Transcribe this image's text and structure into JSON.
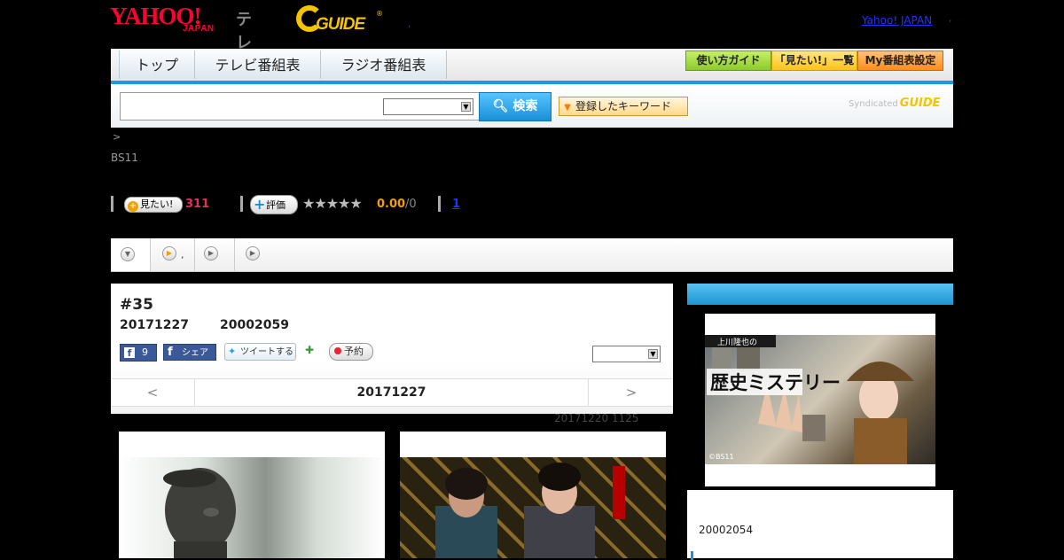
{
  "header": {
    "yahoo_logo": "YAHOO!",
    "yahoo_logo_sub": "JAPAN",
    "tv_label": "テレビ",
    "gguide_logo": "GUIDE",
    "gguide_reg": "®",
    "yahoo_japan_link": "Yahoo! JAPAN",
    "dot_left": ",",
    "dot_right": ","
  },
  "nav": {
    "tabs": [
      {
        "label": "トップ"
      },
      {
        "label": "テレビ番組表"
      },
      {
        "label": "ラジオ番組表"
      }
    ],
    "buttons": [
      {
        "label": "使い方ガイド",
        "color": "#9bd43a"
      },
      {
        "label": "「見たい!」一覧",
        "color": "#ffcc33"
      },
      {
        "label": "My番組表設定",
        "color": "#ff9a33"
      }
    ]
  },
  "search": {
    "input_value": "",
    "select_value": "",
    "button_label": "検索",
    "button_icon": "search-icon",
    "keyword_button_label": "登録したキーワード",
    "syndicated_label": "Syndicated",
    "syndicated_logo": "GUIDE"
  },
  "breadcrumb": ">",
  "program": {
    "channel": "BS11",
    "mitai_label": "見たい!",
    "mitai_count": "311",
    "hyouka_label": "評価",
    "stars": "★★★★★",
    "score": "0.00",
    "score_count": "/0",
    "link_count": "1"
  },
  "tabstrip": {
    "tabs": [
      {
        "icon": "chevron-down-icon",
        "label": ""
      },
      {
        "icon": "play-icon",
        "label": ","
      },
      {
        "icon": "play-icon",
        "label": ""
      },
      {
        "icon": "play-icon",
        "label": ""
      }
    ]
  },
  "episode": {
    "title": "#35",
    "date": "20171227",
    "id": "20002059",
    "fb_like_count": "9",
    "fb_share_label": "シェア",
    "tweet_label": "ツイートする",
    "record_label": "予約",
    "select_value": ""
  },
  "date_nav": {
    "prev": "<",
    "current": "20171227",
    "next": ">"
  },
  "updated": "20171220  1125",
  "right_panel": {
    "image_title": "歴史ミステリー",
    "image_caption_top": "上川隆也の",
    "copyright": "©BS11",
    "program_id": "20002054"
  },
  "colors": {
    "accent_blue": "#1a9be0",
    "rating_orange": "#f0a000",
    "count_pink": "#e0305b",
    "facebook": "#3b5998"
  }
}
